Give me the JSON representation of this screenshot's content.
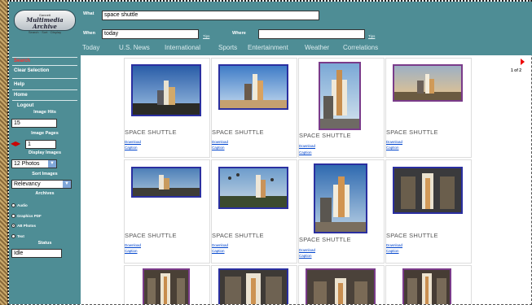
{
  "logo": {
    "line1": "Gannett",
    "line2": "Multimedia Archive",
    "line3": "Search · Sort · Display"
  },
  "sidebar": {
    "search": "Search",
    "clear_selection": "Clear Selection",
    "help": "Help",
    "home": "Home",
    "logout": "Logout",
    "image_hits_label": "Image Hits",
    "image_hits_value": "15",
    "image_pages_label": "Image Pages",
    "image_pages_value": "1",
    "display_images_label": "Display Images",
    "display_images_value": "12 Photos",
    "sort_images_label": "Sort Images",
    "sort_images_value": "Relevancy",
    "archives_label": "Archives",
    "archives": [
      "Audio",
      "Graphics PDF",
      "AB Photos",
      "Text"
    ],
    "archives_selected": "AB Photos",
    "status_label": "Status",
    "status_value": "Idle"
  },
  "topbar": {
    "what_label": "What",
    "what_value": "space shuttle",
    "when_label": "When",
    "when_value": "today",
    "where_label": "Where",
    "where_value": "",
    "tips": "Tips",
    "nav": [
      "Today",
      "U.S. News",
      "International",
      "Sports",
      "Entertainment",
      "Weather",
      "Correlations"
    ]
  },
  "results": [
    {
      "caption": "SPACE SHUTTLE",
      "download": "Download",
      "caption_link": "Caption"
    },
    {
      "caption": "SPACE SHUTTLE",
      "download": "Download",
      "caption_link": "Caption"
    },
    {
      "caption": "SPACE SHUTTLE",
      "download": "Download",
      "caption_link": "Caption"
    },
    {
      "caption": "SPACE SHUTTLE",
      "download": "Download",
      "caption_link": "Caption"
    },
    {
      "caption": "SPACE SHUTTLE",
      "download": "Download",
      "caption_link": "Caption"
    },
    {
      "caption": "SPACE SHUTTLE",
      "download": "Download",
      "caption_link": "Caption"
    },
    {
      "caption": "SPACE SHUTTLE",
      "download": "Download",
      "caption_link": "Caption"
    },
    {
      "caption": "SPACE SHUTTLE",
      "download": "Download",
      "caption_link": "Caption"
    }
  ],
  "pager": {
    "label": "1 of 2"
  },
  "colors": {
    "panel": "#4e8d95",
    "search_red": "#ff3030",
    "thumb_border_blue": "#2a2fa0",
    "thumb_border_purple": "#7a3b8a"
  }
}
